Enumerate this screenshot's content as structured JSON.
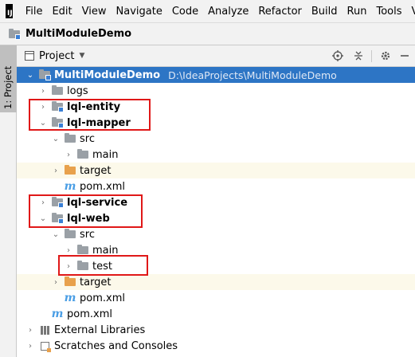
{
  "menubar": {
    "logo_text": "IJ",
    "items": [
      "File",
      "Edit",
      "View",
      "Navigate",
      "Code",
      "Analyze",
      "Refactor",
      "Build",
      "Run",
      "Tools",
      "VCS"
    ]
  },
  "titlebar": {
    "project_name": "MultiModuleDemo"
  },
  "left_stripe": {
    "tab_label": "1: Project"
  },
  "panel": {
    "title": "Project",
    "icons": [
      "locate-icon",
      "collapse-all-icon",
      "settings-icon",
      "hide-panel-icon"
    ]
  },
  "tree": {
    "root": {
      "name": "MultiModuleDemo",
      "path": "D:\\IdeaProjects\\MultiModuleDemo"
    },
    "logs": "logs",
    "entity": "lql-entity",
    "mapper": "lql-mapper",
    "mapper_src": "src",
    "mapper_main": "main",
    "mapper_target": "target",
    "mapper_pom": "pom.xml",
    "service": "lql-service",
    "web": "lql-web",
    "web_src": "src",
    "web_main": "main",
    "web_test": "test",
    "web_target": "target",
    "web_pom": "pom.xml",
    "root_pom": "pom.xml",
    "external_libraries": "External Libraries",
    "scratches": "Scratches and Consoles",
    "maven_glyph": "m"
  },
  "colors": {
    "selection": "#2d75c5",
    "highlight_box": "#e01818",
    "excluded_folder": "#e8a14c",
    "band": "#fcf9ea"
  }
}
